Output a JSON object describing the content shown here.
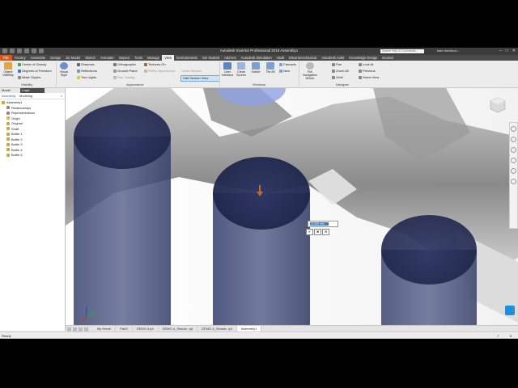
{
  "window": {
    "title": "Autodesk Inventor Professional 2018   Assembly1",
    "search_placeholder": "Search Help & Commands...",
    "user": "kate.davidson...",
    "controls": [
      "–",
      "□",
      "✕"
    ]
  },
  "ribbon_tabs": {
    "file": "File",
    "items": [
      "Factory",
      "Assemble",
      "Design",
      "3D Model",
      "Sketch",
      "Annotate",
      "Inspect",
      "Tools",
      "Manage",
      "View",
      "Environments",
      "Get Started",
      "Add-Ins",
      "Autodesk Simulation",
      "Vault",
      "Electromechanical",
      "Autodesk A360",
      "Knowledge Design",
      "Ecotect"
    ],
    "active": "View"
  },
  "ribbon": {
    "visibility": {
      "object_visibility": "Object Visibility",
      "center_of_gravity": "Center of Gravity",
      "degrees_of_freedom": "Degrees of Freedom",
      "istitute_glyphs": "iMate Glyphs",
      "label": "Visibility"
    },
    "appearance": {
      "visual_style": "Visual Style",
      "shadows": "Shadows",
      "reflections": "Reflections",
      "two_lights": "Two Lights",
      "orthographic": "Orthographic",
      "ground_plane": "Ground Plane",
      "ray_tracing": "Ray Tracing",
      "textures_on": "Textures On",
      "refine_appearance": "Refine Appearance",
      "label": "Appearance"
    },
    "section": {
      "half_section": "Half Section View",
      "undo_section": "Undo Section"
    },
    "windows": {
      "user_interface": "User Interface",
      "clean_screen": "Clean Screen",
      "switch": "Switch",
      "tile_all": "Tile All",
      "cascade": "Cascade",
      "new": "New",
      "label": "Windows"
    },
    "navigate": {
      "full_navigation_wheel": "Full Navigation Wheel",
      "pan": "Pan",
      "zoom_all": "Zoom All",
      "orbit": "Orbit",
      "look_at": "Look At",
      "previous": "Previous",
      "home_view": "Home View",
      "label": "Navigate"
    }
  },
  "browser": {
    "header": "Model",
    "header_logo": "Logic",
    "tab_assembly": "Assembly",
    "tab_modeling": "Modeling",
    "search_icon": "magnifier",
    "tree": [
      {
        "label": "Assembly1",
        "icon": "assembly-icon",
        "color": "#d9a21b"
      },
      {
        "label": "Relationships",
        "icon": "relationships-icon",
        "color": "#8a8a8a"
      },
      {
        "label": "Representations",
        "icon": "representations-icon",
        "color": "#8a8a8a"
      },
      {
        "label": "Origin",
        "icon": "folder-icon",
        "color": "#d9b44a"
      },
      {
        "label": "Original",
        "icon": "part-icon",
        "color": "#c9a74a"
      },
      {
        "label": "Shaft",
        "icon": "part-icon",
        "color": "#c9a74a"
      },
      {
        "label": "Bottle 1",
        "icon": "part-icon",
        "color": "#c9a74a"
      },
      {
        "label": "Bottle 2",
        "icon": "part-icon",
        "color": "#c9a74a"
      },
      {
        "label": "Bottle 3",
        "icon": "part-icon",
        "color": "#c9a74a"
      },
      {
        "label": "Bottle 4",
        "icon": "part-icon",
        "color": "#c9a74a"
      },
      {
        "label": "Bottle 5",
        "icon": "part-icon",
        "color": "#c9a74a"
      }
    ]
  },
  "viewport": {
    "mini_toolbar_value": "12.000 mm",
    "mini_buttons": [
      "✔",
      "✖",
      "⚙"
    ]
  },
  "doc_tabs": {
    "items": [
      "My Home",
      "Part3",
      "DEMO-4.ipt",
      "DEMO-4_Simula...ipt",
      "DEMO-4_Simula...ipt",
      "Assembly1"
    ],
    "active": "Assembly1"
  },
  "status": {
    "left": "Ready",
    "num1": "7",
    "num2": "5"
  },
  "colors": {
    "file_tab": "#d65a1e",
    "accent_blue": "#3a78c9",
    "cylinder": "#2c3560"
  }
}
